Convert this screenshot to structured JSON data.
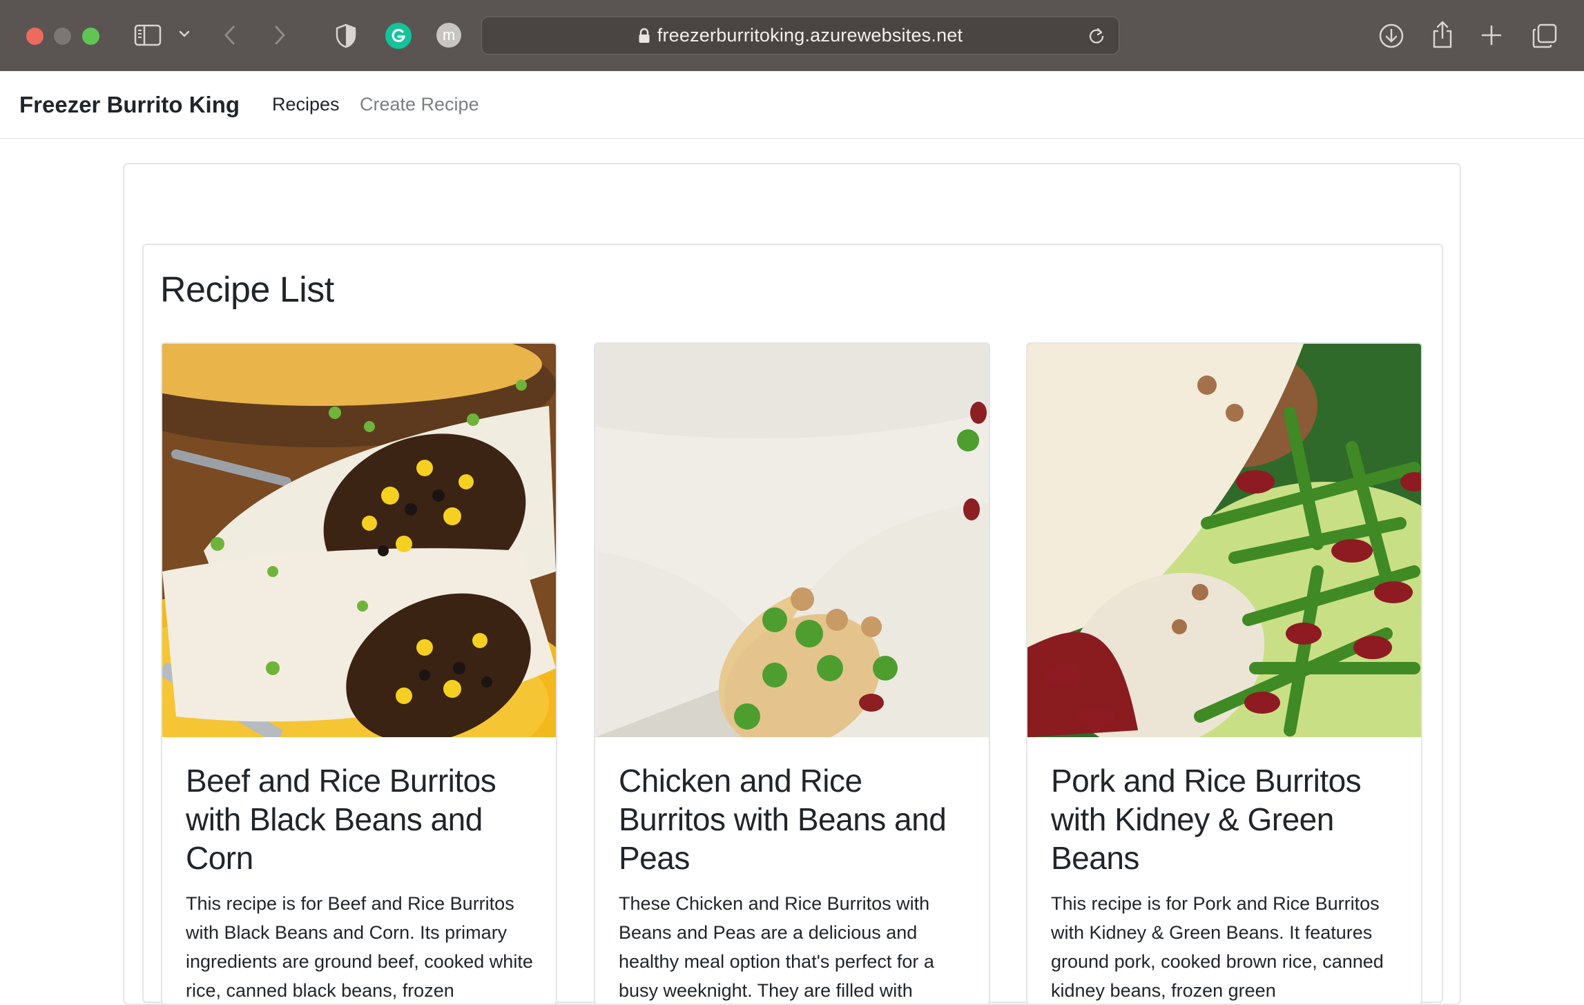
{
  "browser": {
    "url": "freezerburritoking.azurewebsites.net",
    "profile_initial": "m",
    "icons": [
      "sidebar-icon",
      "chevron-down-icon",
      "back-icon",
      "forward-icon",
      "shield-icon",
      "grammarly-icon",
      "profile-icon",
      "lock-icon",
      "reload-icon",
      "download-icon",
      "share-icon",
      "new-tab-icon",
      "tabs-overview-icon"
    ]
  },
  "navbar": {
    "brand": "Freezer Burrito King",
    "links": [
      {
        "label": "Recipes",
        "active": true
      },
      {
        "label": "Create Recipe",
        "active": false
      }
    ]
  },
  "main": {
    "heading": "Recipe List",
    "recipes": [
      {
        "title": "Beef and Rice Burritos with Black Beans and Corn",
        "description": "This recipe is for Beef and Rice Burritos with Black Beans and Corn. Its primary ingredients are ground beef, cooked white rice, canned black beans, frozen"
      },
      {
        "title": "Chicken and Rice Burritos with Beans and Peas",
        "description": "These Chicken and Rice Burritos with Beans and Peas are a delicious and healthy meal option that's perfect for a busy weeknight. They are filled with"
      },
      {
        "title": "Pork and Rice Burritos with Kidney & Green Beans",
        "description": "This recipe is for Pork and Rice Burritos with Kidney & Green Beans. It features ground pork, cooked brown rice, canned kidney beans, frozen green"
      }
    ]
  }
}
